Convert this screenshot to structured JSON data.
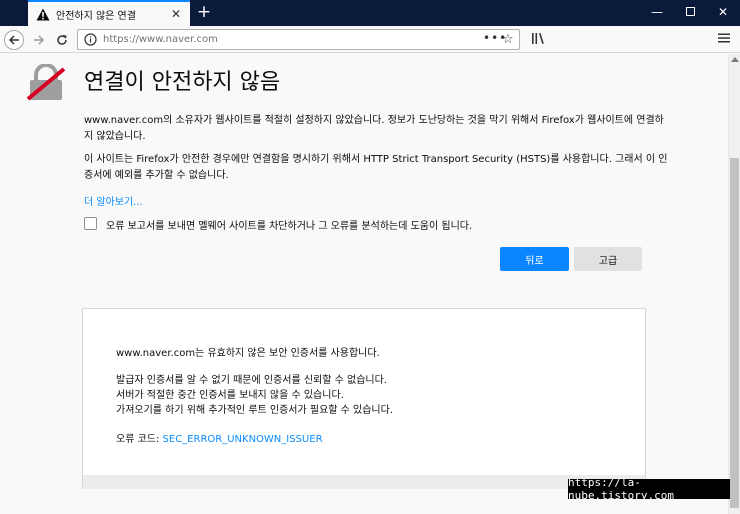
{
  "tab": {
    "title": "안전하지 않은 연결",
    "close_glyph": "✕"
  },
  "window": {
    "new_tab_glyph": "+",
    "minimize_glyph": "—",
    "close_glyph": "✕"
  },
  "navbar": {
    "url": "https://www.naver.com",
    "page_actions_glyph": "•••",
    "bookmark_glyph": "☆"
  },
  "page": {
    "title": "연결이 안전하지 않음",
    "para1": "www.naver.com의 소유자가 웹사이트를 적절히 설정하지 않았습니다. 정보가 도난당하는 것을 막기 위해서 Firefox가 웹사이트에 연결하지 않았습니다.",
    "para2": "이 사이트는 Firefox가 안전한 경우에만 연결함을 명시하기 위해서 HTTP Strict Transport Security (HSTS)를 사용합니다. 그래서 이 인증서에 예외를 추가할 수 없습니다.",
    "learn_more": "더 알아보기...",
    "report_label": "오류 보고서를 보내면 멜웨어 사이트를 차단하거나 그 오류를 분석하는데 도움이 됩니다.",
    "back_button": "뒤로",
    "advanced_button": "고급"
  },
  "advanced": {
    "line1": "www.naver.com는 유효하지 않은 보안 인증서를 사용합니다.",
    "line2": "발급자 인증서를 알 수 없기 때문에 인증서를 신뢰할 수 없습니다.",
    "line3": "서버가 적절한 중간 인증서를 보내지 않을 수 있습니다.",
    "line4": "가져오기를 하기 위해 추가적인 루트 인증서가 필요할 수 있습니다.",
    "error_label": "오류 코드: ",
    "error_code": "SEC_ERROR_UNKNOWN_ISSUER"
  },
  "watermark": "https://la-nube.tistory.com",
  "colors": {
    "accent": "#0a84ff",
    "titlebar": "#0a1a3a",
    "link": "#0a8dff",
    "warning_red": "#d70022"
  },
  "icons": {
    "tab": "warning-icon",
    "back": "back-arrow-icon",
    "forward": "forward-arrow-icon",
    "reload": "reload-icon",
    "site_info": "info-icon",
    "library": "library-icon",
    "menu": "hamburger-menu-icon",
    "page": "broken-lock-icon"
  }
}
